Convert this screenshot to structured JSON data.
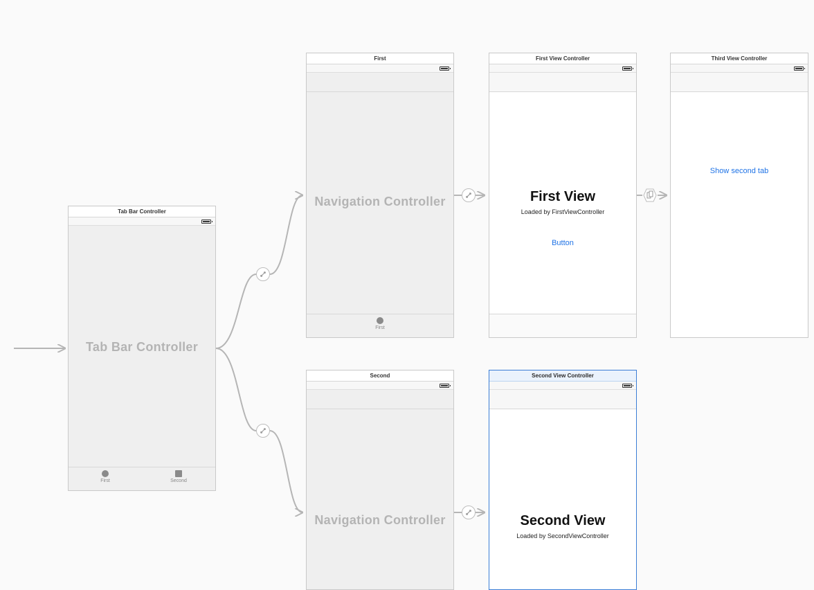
{
  "tabbar_scene": {
    "title": "Tab Bar Controller",
    "body_label": "Tab Bar Controller",
    "tabs": [
      {
        "label": "First"
      },
      {
        "label": "Second"
      }
    ]
  },
  "nav1_scene": {
    "title": "First",
    "body_label": "Navigation Controller",
    "tab_label": "First"
  },
  "nav2_scene": {
    "title": "Second",
    "body_label": "Navigation Controller"
  },
  "first_vc": {
    "title": "First View Controller",
    "heading": "First View",
    "subtitle": "Loaded by FirstViewController",
    "button": "Button"
  },
  "second_vc": {
    "title": "Second View Controller",
    "heading": "Second View",
    "subtitle": "Loaded by SecondViewController"
  },
  "third_vc": {
    "title": "Third View Controller",
    "button": "Show second tab"
  }
}
